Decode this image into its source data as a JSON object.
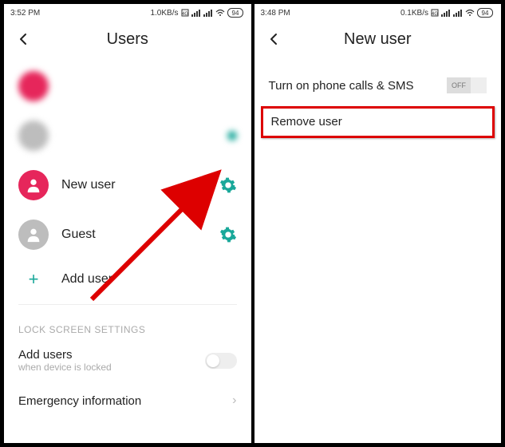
{
  "left": {
    "status": {
      "time": "3:52 PM",
      "net": "1.0KB/s",
      "battery": "94"
    },
    "title": "Users",
    "blurred_users": [
      {
        "avatar": "pink",
        "label": "—"
      },
      {
        "avatar": "grey",
        "label": "—"
      }
    ],
    "users": [
      {
        "avatar": "pink",
        "label": "New user",
        "gear": true
      },
      {
        "avatar": "grey",
        "label": "Guest",
        "gear": true
      }
    ],
    "add_user": "Add user",
    "section_header": "LOCK SCREEN SETTINGS",
    "setting1": {
      "title": "Add users",
      "sub": "when device is locked"
    },
    "setting2": {
      "title": "Emergency information"
    }
  },
  "right": {
    "status": {
      "time": "3:48 PM",
      "net": "0.1KB/s",
      "battery": "94"
    },
    "title": "New user",
    "row1": {
      "label": "Turn on phone calls & SMS",
      "toggle": "OFF"
    },
    "row2": {
      "label": "Remove user"
    }
  }
}
